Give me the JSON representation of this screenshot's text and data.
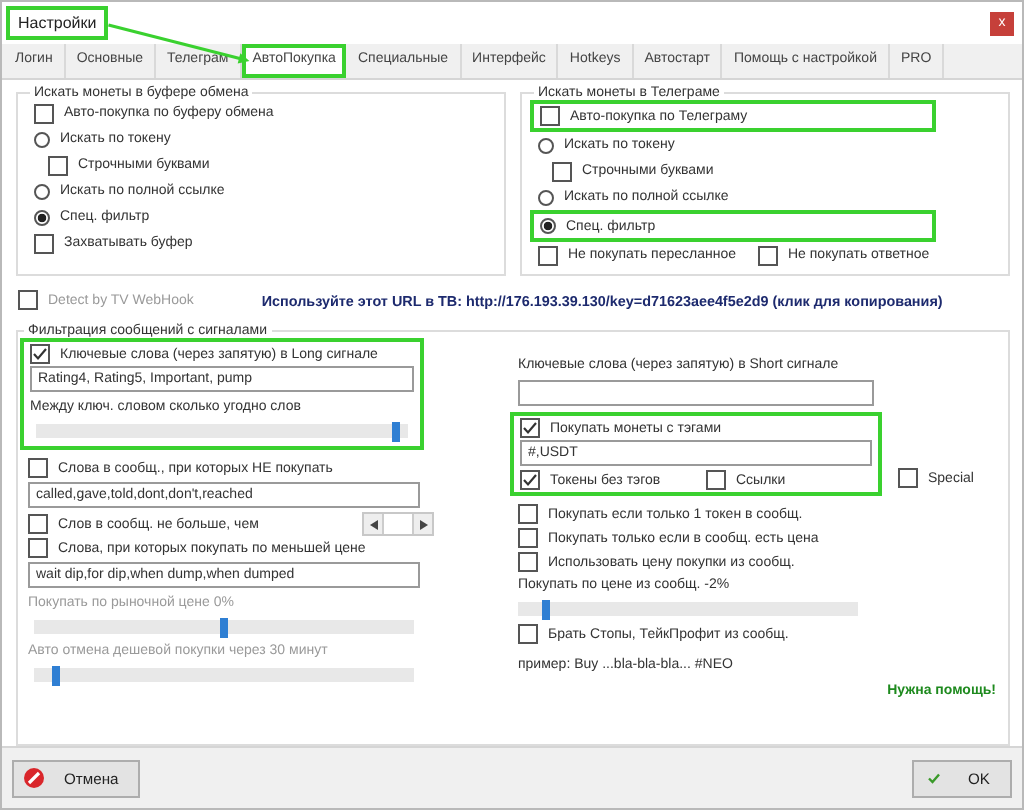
{
  "window": {
    "title": "Настройки",
    "title_highlighted": true,
    "title_pointer": true,
    "close": "x"
  },
  "tabs": [
    {
      "label": "Логин",
      "selected": false,
      "highlighted": false
    },
    {
      "label": "Основные",
      "selected": false,
      "highlighted": false
    },
    {
      "label": "Телеграм",
      "selected": false,
      "highlighted": false
    },
    {
      "label": "АвтоПокупка",
      "selected": true,
      "highlighted": true
    },
    {
      "label": "Специальные",
      "selected": false,
      "highlighted": false
    },
    {
      "label": "Интерфейс",
      "selected": false,
      "highlighted": false
    },
    {
      "label": "Hotkeys",
      "selected": false,
      "highlighted": false
    },
    {
      "label": "Автостарт",
      "selected": false,
      "highlighted": false
    },
    {
      "label": "Помощь с настройкой",
      "selected": false,
      "highlighted": false
    },
    {
      "label": "PRO",
      "selected": false,
      "highlighted": false
    }
  ],
  "groups": [
    {
      "title": "Искать монеты в буфере обмена",
      "items": [
        {
          "kind": "checkbox",
          "label": "Авто-покупка по буферу обмена",
          "checked": false
        },
        {
          "kind": "radio",
          "label": "Искать по токену",
          "selected": false
        },
        {
          "kind": "sub_checkbox",
          "label": "Строчными буквами",
          "checked": false
        },
        {
          "kind": "radio",
          "label": "Искать по полной ссылке",
          "selected": false
        },
        {
          "kind": "radio",
          "label": "Спец. фильтр",
          "selected": true
        },
        {
          "kind": "checkbox",
          "label": "Захватывать буфер",
          "checked": false
        }
      ]
    },
    {
      "title": "Искать монеты в Телеграме",
      "items": [
        {
          "kind": "highlight",
          "items": [
            {
              "kind": "checkbox",
              "label": "Авто-покупка по Телеграму",
              "checked": false
            }
          ]
        },
        {
          "kind": "radio",
          "label": "Искать по токену",
          "selected": false
        },
        {
          "kind": "sub_checkbox",
          "label": "Строчными буквами",
          "checked": false
        },
        {
          "kind": "radio",
          "label": "Искать по полной ссылке",
          "selected": false
        },
        {
          "kind": "highlight",
          "items": [
            {
              "kind": "radio",
              "label": "Спец. фильтр",
              "selected": true
            }
          ]
        },
        {
          "kind": "checkbox_row",
          "items": [
            {
              "kind": "checkbox",
              "label": "Не покупать пересланное",
              "checked": false
            },
            {
              "kind": "checkbox",
              "label": "Не покупать ответное",
              "checked": false
            }
          ]
        }
      ]
    }
  ],
  "webhook": {
    "label": "Detect by TV WebHook",
    "checked": false,
    "disabled": true,
    "url_text": "Используйте этот URL в ТВ: http://176.193.39.130/key=d71623aee4f5e2d9 (клик для копирования)"
  },
  "filter": {
    "title": "Фильтрация сообщений с сигналами",
    "left": [
      {
        "kind": "highlight",
        "items": [
          {
            "kind": "checkbox",
            "label": "Ключевые слова (через запятую) в Long сигнале",
            "checked": true
          },
          {
            "kind": "field",
            "value": "Rating4, Rating5, Important, pump"
          },
          {
            "kind": "label",
            "text": "Между ключ. словом сколько угодно слов",
            "disabled": false
          },
          {
            "kind": "slider",
            "level": 0.97
          }
        ]
      },
      {
        "kind": "checkbox",
        "label": "Слова в сообщ., при которых НЕ покупать",
        "checked": false
      },
      {
        "kind": "field",
        "value": "called,gave,told,dont,don't,reached"
      },
      {
        "kind": "checkbox_spinner",
        "label": "Слов в сообщ. не больше, чем",
        "checked": false
      },
      {
        "kind": "checkbox",
        "label": "Слова, при которых покупать по меньшей цене",
        "checked": false
      },
      {
        "kind": "field",
        "value": "wait dip,for dip,when dump,when dumped"
      },
      {
        "kind": "label",
        "text": "Покупать по рыночной цене 0%",
        "disabled": true
      },
      {
        "kind": "slider",
        "level": 0.5
      },
      {
        "kind": "label",
        "text": "Авто отмена дешевой покупки через 30 минут",
        "disabled": true
      },
      {
        "kind": "slider",
        "level": 0.06
      }
    ],
    "right": [
      {
        "kind": "label",
        "text": "Ключевые слова (через запятую) в Short сигнале",
        "disabled": false
      },
      {
        "kind": "field"
      },
      {
        "kind": "highlight_side",
        "items": [
          {
            "kind": "checkbox",
            "label": "Покупать монеты с тэгами",
            "checked": true
          },
          {
            "kind": "field",
            "value": "#,USDT"
          },
          {
            "kind": "checkbox_row",
            "items": [
              {
                "kind": "checkbox",
                "label": "Токены без тэгов",
                "checked": true
              },
              {
                "kind": "checkbox",
                "label": "Ссылки",
                "checked": false
              }
            ]
          }
        ],
        "side": {
          "kind": "checkbox",
          "label": "Special",
          "checked": false
        }
      },
      {
        "kind": "checkbox",
        "label": "Покупать если только 1 токен в сообщ.",
        "checked": false
      },
      {
        "kind": "checkbox",
        "label": "Покупать только если в сообщ. есть цена",
        "checked": false
      },
      {
        "kind": "checkbox",
        "label": "Использовать цену покупки из сообщ.",
        "checked": false
      },
      {
        "kind": "label",
        "text": "Покупать по цене из сообщ. -2%",
        "disabled": false
      },
      {
        "kind": "slider",
        "level": 0.08
      },
      {
        "kind": "checkbox",
        "label": "Брать Стопы, ТейкПрофит из сообщ.",
        "checked": false
      },
      {
        "kind": "text",
        "text": "пример: Buy ...bla-bla-bla... #NEO"
      },
      {
        "kind": "link",
        "text": "Нужна помощь!"
      }
    ]
  },
  "buttons": [
    {
      "kind": "cancel",
      "label": "Отмена"
    },
    {
      "kind": "ok",
      "label": "OK"
    }
  ]
}
